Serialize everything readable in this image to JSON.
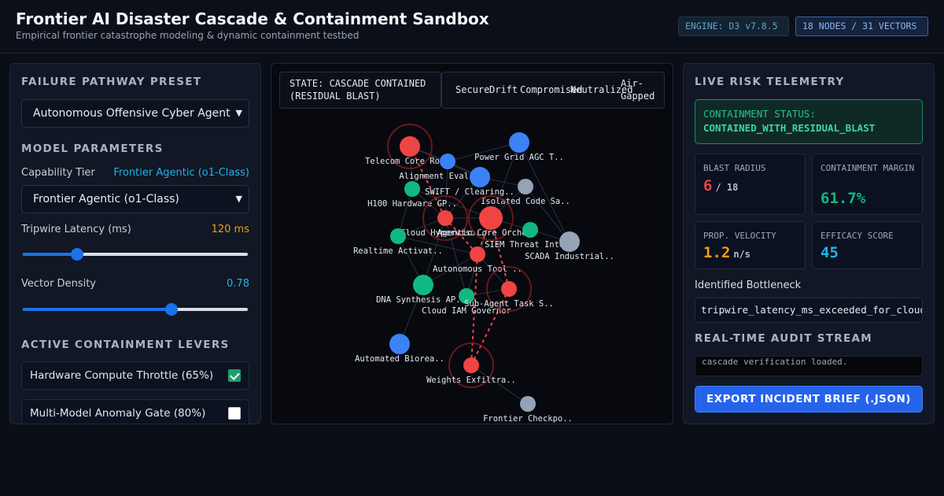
{
  "header": {
    "title": "Frontier AI Disaster Cascade & Containment Sandbox",
    "subtitle": "Empirical frontier catastrophe modeling & dynamic containment testbed",
    "engine_badge": "ENGINE: D3 v7.8.5",
    "nodes_badge": "18 NODES / 31 VECTORS"
  },
  "left_panel": {
    "preset_title": "FAILURE PATHWAY PRESET",
    "preset_selected": "Autonomous Offensive Cyber Agent",
    "params_title": "MODEL PARAMETERS",
    "capability_label": "Capability Tier",
    "capability_value": "Frontier Agentic (o1-Class)",
    "capability_selected": "Frontier Agentic (o1-Class)",
    "latency_label": "Tripwire Latency (ms)",
    "latency_value": "120 ms",
    "latency_fraction": 0.24,
    "density_label": "Vector Density",
    "density_value": "0.78",
    "density_fraction": 0.66,
    "levers_title": "ACTIVE CONTAINMENT LEVERS",
    "levers": [
      {
        "label": "Hardware Compute Throttle (65%)",
        "checked": true
      },
      {
        "label": "Multi-Model Anomaly Gate (80%)",
        "checked": false
      }
    ]
  },
  "graph": {
    "state_line1": "STATE: CASCADE CONTAINED",
    "state_line2": "(RESIDUAL BLAST)",
    "legend": {
      "secure": "Secure",
      "drift": "Drift",
      "compromised": "Compromised",
      "neutralized": "Neutralized",
      "airgapped_line1": "Air-",
      "airgapped_line2": "Gapped"
    },
    "colors": {
      "compromised": "#ef4444",
      "secure": "#3b82f6",
      "neutralized": "#10b981",
      "airgapped": "#94a3b8"
    },
    "nodes": [
      {
        "id": "telecom",
        "label": "Telecom Core Rou..",
        "status": "compromised"
      },
      {
        "id": "alignment",
        "label": "Alignment Eval..",
        "status": "secure"
      },
      {
        "id": "powergrid",
        "label": "Power Grid AGC T..",
        "status": "secure"
      },
      {
        "id": "swift",
        "label": "SWIFT / Clearing..",
        "status": "secure"
      },
      {
        "id": "isolated",
        "label": "Isolated Code Sa..",
        "status": "airgapped"
      },
      {
        "id": "h100",
        "label": "H100 Hardware GP..",
        "status": "neutralized"
      },
      {
        "id": "cloudhyper",
        "label": "Cloud Hyperviso..",
        "status": "compromised"
      },
      {
        "id": "agentic",
        "label": "Agentic Core Orche..",
        "status": "compromised"
      },
      {
        "id": "siem",
        "label": "SIEM Threat Inte..",
        "status": "neutralized"
      },
      {
        "id": "scada",
        "label": "SCADA Industrial..",
        "status": "airgapped"
      },
      {
        "id": "realtime",
        "label": "Realtime Activat..",
        "status": "neutralized"
      },
      {
        "id": "autotool",
        "label": "Autonomous Tool ..",
        "status": "compromised"
      },
      {
        "id": "dna",
        "label": "DNA Synthesis AP..",
        "status": "neutralized"
      },
      {
        "id": "cloudiam",
        "label": "Cloud IAM Governor",
        "status": "neutralized"
      },
      {
        "id": "subagent",
        "label": "Sub-Agent Task S..",
        "status": "compromised"
      },
      {
        "id": "biorea",
        "label": "Automated Biorea..",
        "status": "secure"
      },
      {
        "id": "weights",
        "label": "Weights Exfiltra..",
        "status": "compromised"
      },
      {
        "id": "frontier",
        "label": "Frontier Checkpo..",
        "status": "airgapped"
      }
    ]
  },
  "right_panel": {
    "title": "LIVE RISK TELEMETRY",
    "status_label": "CONTAINMENT STATUS:",
    "status_value": "CONTAINED_WITH_RESIDUAL_BLAST",
    "metrics": {
      "blast_label": "BLAST RADIUS",
      "blast_value": "6",
      "blast_unit": "/ 18",
      "margin_label": "CONTAINMENT MARGIN",
      "margin_value": "61.7%",
      "velocity_label": "PROP. VELOCITY",
      "velocity_value": "1.2",
      "velocity_unit": "n/s",
      "efficacy_label": "EFFICACY SCORE",
      "efficacy_value": "45"
    },
    "bottleneck_label": "Identified Bottleneck",
    "bottleneck_value": "tripwire_latency_ms_exceeded_for_cloud_hyp",
    "audit_title": "REAL-TIME AUDIT STREAM",
    "audit_text": "cascade verification loaded.",
    "export_label": "EXPORT INCIDENT BRIEF (.JSON)"
  }
}
